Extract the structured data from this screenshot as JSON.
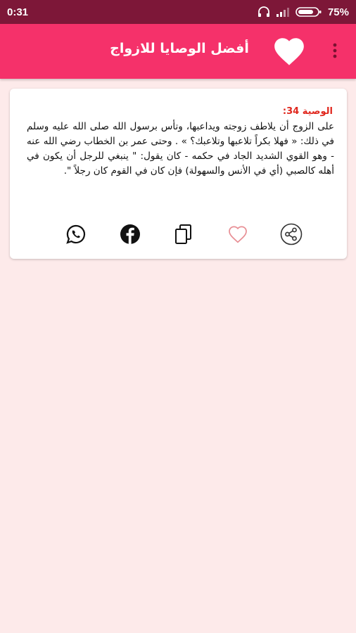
{
  "status_bar": {
    "time": "0:31",
    "battery": "75%"
  },
  "app_bar": {
    "title": "أفضل الوصايا للازواج"
  },
  "tip": {
    "label": "الوصية 34:",
    "text": "على الزوج أن يلاطف زوجته ويداعبها، وتأس برسول الله صلى الله عليه وسلم في ذلك: « فهلا بكراً تلاعبها وتلاعبك؟ » . وحتى عمر بن الخطاب رضي الله عنه - وهو القوي الشديد الجاد في حكمه - كان يقول: \" ينبغي للرجل أن يكون في أهله كالصبي (أي في الأنس والسهولة) فإن كان في القوم كان رجلاً \"."
  },
  "icons": {
    "whatsapp": "whatsapp-icon",
    "facebook": "facebook-icon",
    "copy": "copy-icon",
    "favorite": "heart-outline-icon",
    "share": "share-icon"
  },
  "colors": {
    "status_bar": "#7d1738",
    "app_bar": "#f5316a",
    "background": "#fdeaea",
    "tip_label": "#e0271d",
    "favorite_outline": "#e88f95"
  }
}
